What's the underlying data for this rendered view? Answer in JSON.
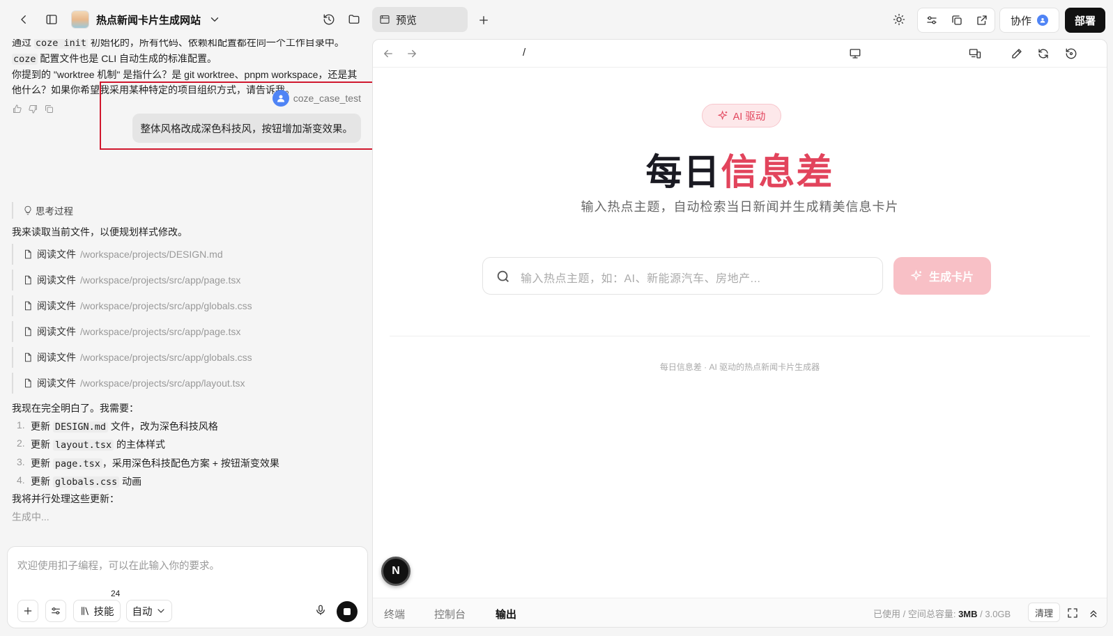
{
  "header": {
    "project_title": "热点新闻卡片生成网站",
    "preview_tab": "预览",
    "collab_label": "协作",
    "deploy_label": "部署"
  },
  "chat": {
    "para1_a": "通过 ",
    "para1_code1": "coze init",
    "para1_b": " 初始化的，所有代码、依赖和配置都在同一个工作目录中。",
    "para2_code": "coze",
    "para2": " 配置文件也是 CLI 自动生成的标准配置。",
    "para3": "你提到的 \"worktree 机制\" 是指什么？是 git worktree、pnpm workspace，还是其他什么？如果你希望我采用某种特定的项目组织方式，请告诉我。",
    "user_name": "coze_case_test",
    "user_message": "整体风格改成深色科技风，按钮增加渐变效果。",
    "think_label": "思考过程",
    "intro": "我来读取当前文件，以便规划样式修改。",
    "read_label": "阅读文件",
    "reads": [
      "/workspace/projects/DESIGN.md",
      "/workspace/projects/src/app/page.tsx",
      "/workspace/projects/src/app/globals.css",
      "/workspace/projects/src/app/page.tsx",
      "/workspace/projects/src/app/globals.css",
      "/workspace/projects/src/app/layout.tsx"
    ],
    "understand": "我现在完全明白了。我需要：",
    "steps": [
      {
        "num": "1.",
        "pre": "更新 ",
        "code": "DESIGN.md",
        "post": " 文件，改为深色科技风格"
      },
      {
        "num": "2.",
        "pre": "更新 ",
        "code": "layout.tsx",
        "post": " 的主体样式"
      },
      {
        "num": "3.",
        "pre": "更新 ",
        "code": "page.tsx",
        "post": "，采用深色科技配色方案 + 按钮渐变效果"
      },
      {
        "num": "4.",
        "pre": "更新 ",
        "code": "globals.css",
        "post": " 动画"
      }
    ],
    "parallel": "我将并行处理这些更新：",
    "generating": "生成中..."
  },
  "input": {
    "placeholder": "欢迎使用扣子编程，可以在此输入你的要求。",
    "skill_label": "技能",
    "skill_count": "24",
    "mode_label": "自动"
  },
  "preview": {
    "url": "/",
    "badge": "AI 驱动",
    "title_a": "每日",
    "title_b": "信息差",
    "subtitle": "输入热点主题，自动检索当日新闻并生成精美信息卡片",
    "search_placeholder": "输入热点主题，如：AI、新能源汽车、房地产...",
    "generate_label": "生成卡片",
    "footer": "每日信息差 · AI 驱动的热点新闻卡片生成器",
    "n_label": "N"
  },
  "bottom": {
    "tabs": [
      "终端",
      "控制台",
      "输出"
    ],
    "usage_prefix": "已使用 / 空间总容量: ",
    "used": "3MB",
    "sep": " / ",
    "total": "3.0GB",
    "clear_label": "清理"
  },
  "colors": {
    "accent": "#e2445c",
    "user_avatar": "#4f84f5",
    "highlight_border": "#d0172d"
  }
}
